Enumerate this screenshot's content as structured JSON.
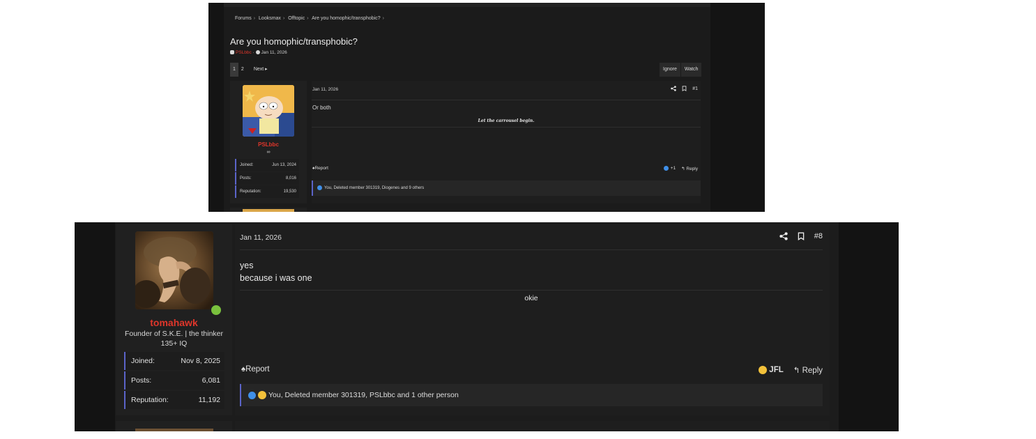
{
  "shot1": {
    "breadcrumb": [
      "Forums",
      "Looksmax",
      "Offtopic",
      "Are you homophic/transphobic?"
    ],
    "thread_title": "Are you homophic/transphobic?",
    "author": "PSLbbc",
    "meta_sep": "·",
    "date": "Jan 11, 2026",
    "pages": [
      "1",
      "2"
    ],
    "next_label": "Next",
    "ignore_label": "Ignore",
    "watch_label": "Watch",
    "user": {
      "username": "PSLbbc",
      "title": "∞",
      "stats": [
        {
          "label": "Joined:",
          "value": "Jun 13, 2024"
        },
        {
          "label": "Posts:",
          "value": "8,016"
        },
        {
          "label": "Reputation:",
          "value": "19,530"
        }
      ]
    },
    "post": {
      "date": "Jan 11, 2026",
      "number": "#1",
      "body": "Or both",
      "signature": "Let the carrousel begin.",
      "report_label": "Report",
      "reaction_count": "+1",
      "reply_label": "Reply",
      "likes_text": "You, Deleted member 301319, Diogenes and 9 others"
    }
  },
  "shot2": {
    "user": {
      "username": "tomahawk",
      "title_line1": "Founder of S.K.E. | the thinker",
      "title_line2": "135+ IQ",
      "stats": [
        {
          "label": "Joined:",
          "value": "Nov 8, 2025"
        },
        {
          "label": "Posts:",
          "value": "6,081"
        },
        {
          "label": "Reputation:",
          "value": "11,192"
        }
      ]
    },
    "post": {
      "date": "Jan 11, 2026",
      "number": "#8",
      "body_line1": "yes",
      "body_line2": "because i was one",
      "signature": "okie",
      "report_label": "Report",
      "reaction_label": "JFL",
      "reply_label": "Reply",
      "likes_text": "You, Deleted member 301319, PSLbbc and 1 other person"
    }
  },
  "colors": {
    "username_red": "#e0362b",
    "accent_blue": "#5b64c9",
    "online_green": "#7ac13d",
    "like_blue": "#3f8fe8"
  }
}
